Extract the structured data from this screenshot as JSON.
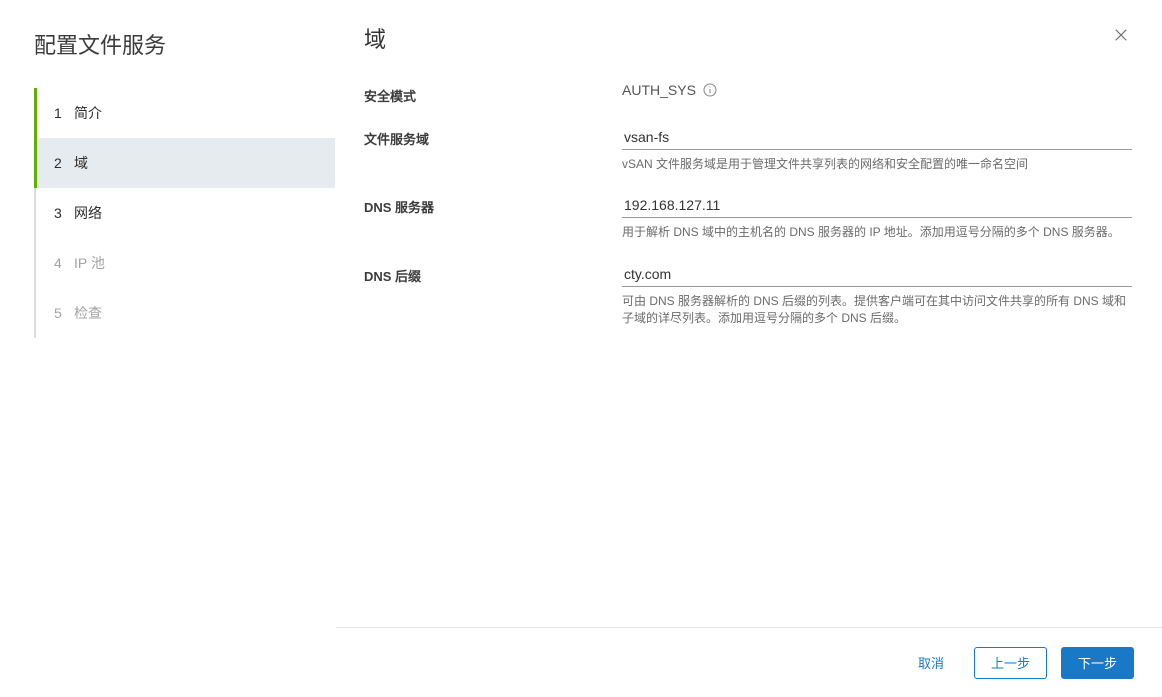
{
  "sidebar": {
    "title": "配置文件服务",
    "steps": [
      {
        "num": "1",
        "label": "简介"
      },
      {
        "num": "2",
        "label": "域"
      },
      {
        "num": "3",
        "label": "网络"
      },
      {
        "num": "4",
        "label": "IP 池"
      },
      {
        "num": "5",
        "label": "检查"
      }
    ]
  },
  "main": {
    "title": "域"
  },
  "form": {
    "security_mode": {
      "label": "安全模式",
      "value": "AUTH_SYS"
    },
    "domain": {
      "label": "文件服务域",
      "value": "vsan-fs",
      "help": "vSAN 文件服务域是用于管理文件共享列表的网络和安全配置的唯一命名空间"
    },
    "dns_servers": {
      "label": "DNS 服务器",
      "value": "192.168.127.11",
      "help": "用于解析 DNS 域中的主机名的 DNS 服务器的 IP 地址。添加用逗号分隔的多个 DNS 服务器。"
    },
    "dns_suffix": {
      "label": "DNS 后缀",
      "value": "cty.com",
      "help": "可由 DNS 服务器解析的 DNS 后缀的列表。提供客户端可在其中访问文件共享的所有 DNS 域和子域的详尽列表。添加用逗号分隔的多个 DNS 后缀。"
    }
  },
  "footer": {
    "cancel": "取消",
    "back": "上一步",
    "next": "下一步"
  }
}
